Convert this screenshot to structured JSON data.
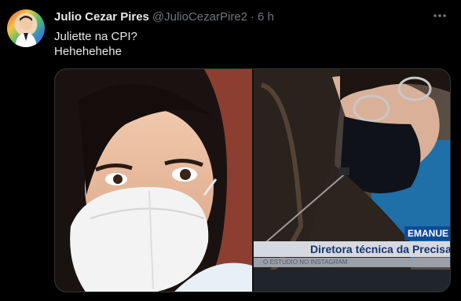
{
  "tweet": {
    "display_name": "Julio Cezar Pires",
    "handle": "@JulioCezarPire2",
    "separator": "·",
    "time": "6 h",
    "text_lines": [
      "Juliette na CPI?",
      "Hehehehehe"
    ]
  },
  "media": {
    "right_image_chyron": {
      "name": "EMANUE",
      "title": "Diretora técnica da Precisa",
      "ticker": "O ESTUDIO NO INSTAGRAM"
    }
  },
  "icons": {
    "more": "more-horizontal-icon"
  },
  "colors": {
    "background": "#000000",
    "primary_text": "#e7e9ea",
    "secondary_text": "#71767b",
    "border": "#2f3336",
    "chyron_blue": "#0e4a97"
  }
}
